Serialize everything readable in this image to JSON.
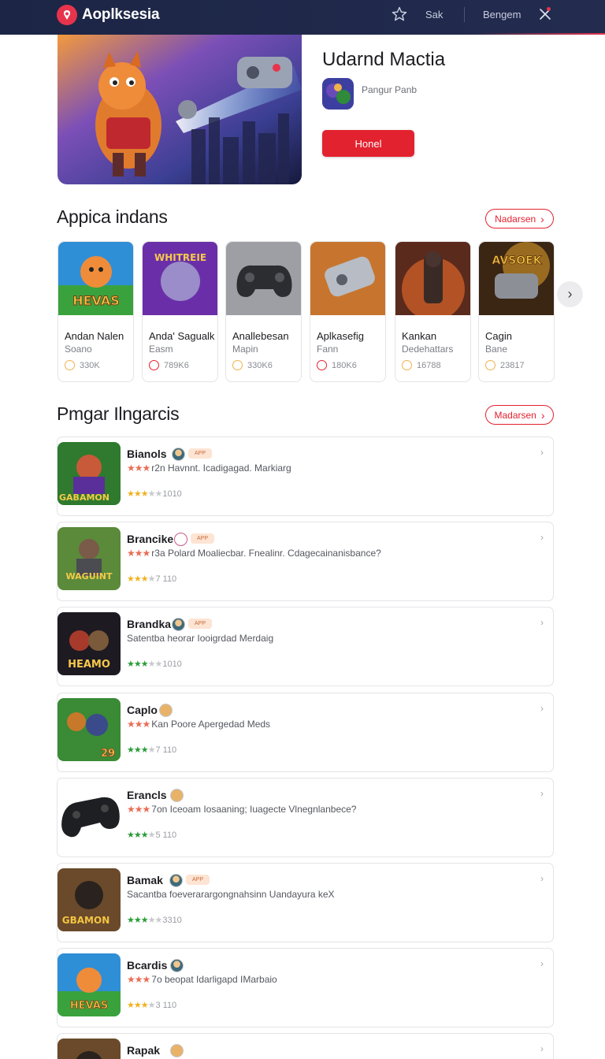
{
  "header": {
    "brand": "Aoplksesia",
    "search_label": "Sak",
    "language_label": "Bengem",
    "icons": [
      "logo-icon",
      "star-icon",
      "close-icon"
    ]
  },
  "hero": {
    "title": "Udarnd Mactia",
    "developer": "Pangur Panb",
    "button_label": "Honel"
  },
  "section1": {
    "title": "Appica indans",
    "more_label": "Nadarsen",
    "apps": [
      {
        "name": "Andan Nalen",
        "category": "Soano",
        "downloads": "330K",
        "art_text": "HEVAS"
      },
      {
        "name": "Anda' Sagualk",
        "category": "Easm",
        "downloads": "789K6",
        "art_text": "WHITREIE"
      },
      {
        "name": "Anallebesan",
        "category": "Mapin",
        "downloads": "330K6"
      },
      {
        "name": "Aplkasefig",
        "category": "Fann",
        "downloads": "180K6"
      },
      {
        "name": "Kankan",
        "category": "Dedehattars",
        "downloads": "16788"
      },
      {
        "name": "Cagin",
        "category": "Bane",
        "downloads": "23817",
        "art_text": "AVSOEK"
      }
    ]
  },
  "section2": {
    "title": "Pmgar Ilngarcis",
    "more_label": "Madarsen",
    "rows": [
      {
        "name": "Bianols",
        "desc": "r2n Havnnt. Icadigagad. Markiarg",
        "rating": "1010",
        "art_text": "GABAMON",
        "has_tag": true
      },
      {
        "name": "Brancike",
        "desc": "r3a Polard Moaliecbar. Fnealinr. Cdagecainanisbance?",
        "rating": "7 110",
        "art_text": "WAGUINT",
        "has_tag": true
      },
      {
        "name": "Brandka",
        "desc": "Satentba heorar Iooigrdad Merdaig",
        "rating": "1010",
        "art_text": "HEAMO",
        "has_tag": true
      },
      {
        "name": "Caplo",
        "desc": "Kan Poore Apergedad Meds",
        "rating": "7 110",
        "art_text": "29"
      },
      {
        "name": "Erancls",
        "desc": "7on Iceoam Iosaaning; Iuagecte Vlnegnlanbece?",
        "rating": "5 110"
      },
      {
        "name": "Bamak",
        "desc": "Sacantba foeverarargongnahsinn Uandayura keX",
        "rating": "3310",
        "art_text": "GBAMON",
        "has_tag": true
      },
      {
        "name": "Bcardis",
        "desc": "7o beopat Idarligapd IMarbaio",
        "rating": "3 110",
        "art_text": "HEVAS"
      },
      {
        "name": "Rapak",
        "desc": "",
        "rating": ""
      }
    ],
    "tag_label": "APP"
  }
}
